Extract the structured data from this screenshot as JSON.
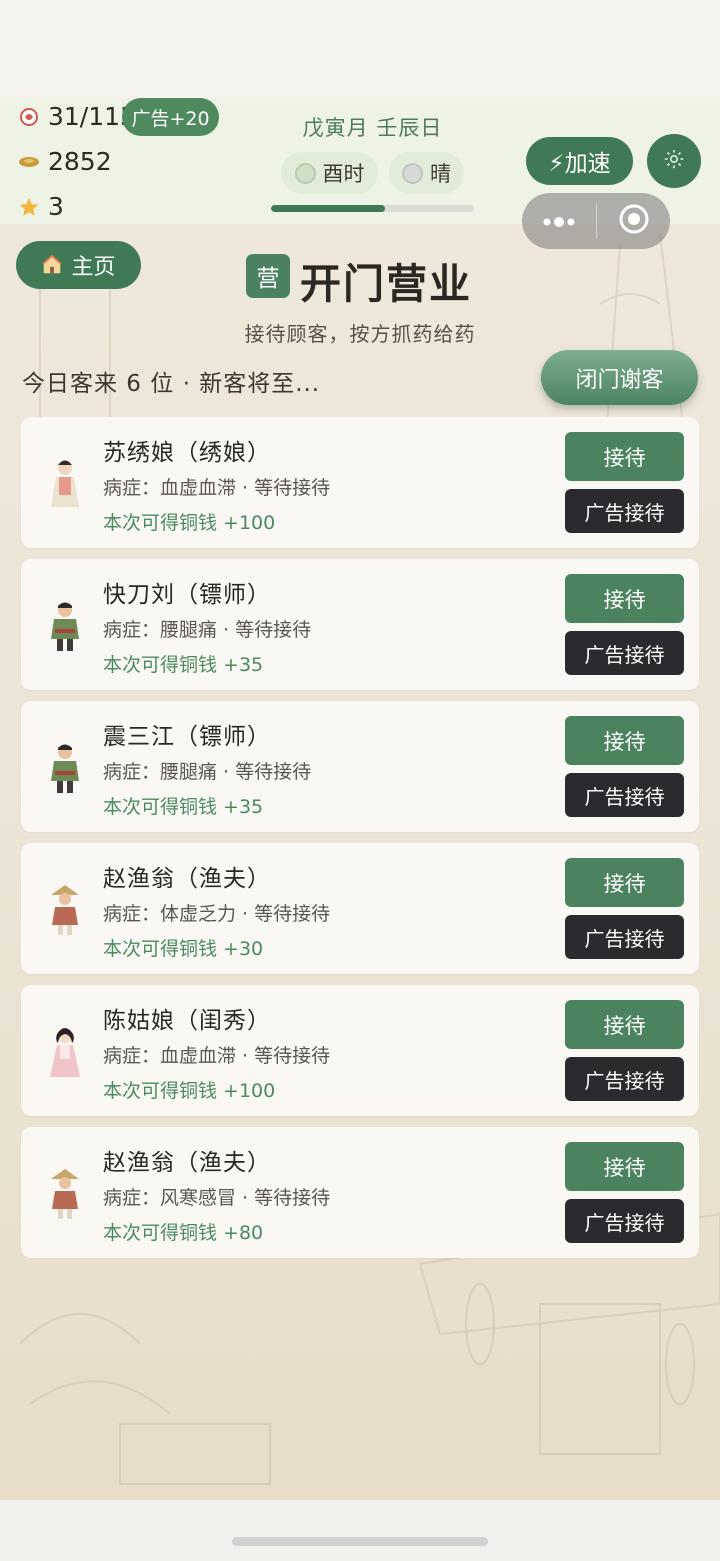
{
  "status": {
    "energy": "31/115",
    "ad_bonus": "广告+20",
    "coins": "2852",
    "stars": "3"
  },
  "calendar": {
    "date": "戊寅月 壬辰日",
    "hour": "酉时",
    "weather": "晴",
    "day_progress": 0.56
  },
  "controls": {
    "speed_label": "⚡加速",
    "settings_icon": "gear-icon",
    "capsule_more_icon": "more-icon",
    "capsule_close_icon": "target-icon"
  },
  "nav": {
    "home_label": "主页"
  },
  "page": {
    "badge": "营",
    "title": "开门营业",
    "subtitle": "接待顾客，按方抓药给药",
    "customer_count": "今日客来 6 位 · 新客将至...",
    "close_button": "闭门谢客"
  },
  "customers": [
    {
      "name": "苏绣娘（绣娘）",
      "illness": "病症：血虚血滞 · 等待接待",
      "reward": "本次可得铜钱 +100",
      "serve": "接待",
      "ad_serve": "广告接待"
    },
    {
      "name": "快刀刘（镖师）",
      "illness": "病症：腰腿痛 · 等待接待",
      "reward": "本次可得铜钱 +35",
      "serve": "接待",
      "ad_serve": "广告接待"
    },
    {
      "name": "震三江（镖师）",
      "illness": "病症：腰腿痛 · 等待接待",
      "reward": "本次可得铜钱 +35",
      "serve": "接待",
      "ad_serve": "广告接待"
    },
    {
      "name": "赵渔翁（渔夫）",
      "illness": "病症：体虚乏力 · 等待接待",
      "reward": "本次可得铜钱 +30",
      "serve": "接待",
      "ad_serve": "广告接待"
    },
    {
      "name": "陈姑娘（闺秀）",
      "illness": "病症：血虚血滞 · 等待接待",
      "reward": "本次可得铜钱 +100",
      "serve": "接待",
      "ad_serve": "广告接待"
    },
    {
      "name": "赵渔翁（渔夫）",
      "illness": "病症：风寒感冒 · 等待接待",
      "reward": "本次可得铜钱 +80",
      "serve": "接待",
      "ad_serve": "广告接待"
    }
  ],
  "colors": {
    "primary_green": "#3f7a55",
    "reward_green": "#4b8a5f",
    "ad_button": "#2b2a2e"
  }
}
